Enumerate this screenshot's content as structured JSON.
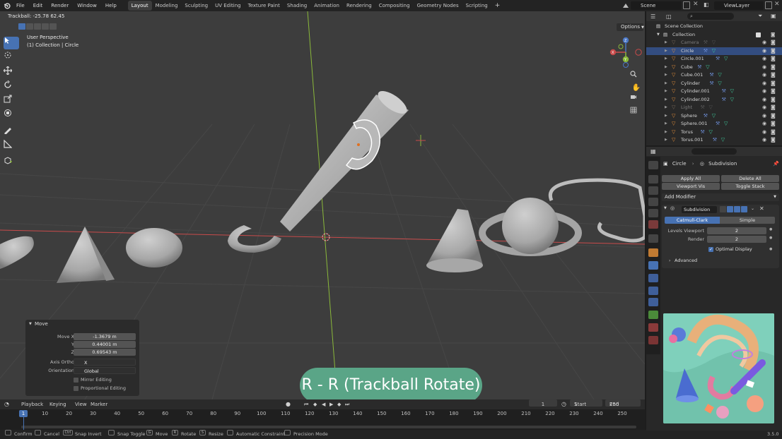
{
  "menu": [
    "File",
    "Edit",
    "Render",
    "Window",
    "Help"
  ],
  "workspaces": [
    "Layout",
    "Modeling",
    "Sculpting",
    "UV Editing",
    "Texture Paint",
    "Shading",
    "Animation",
    "Rendering",
    "Compositing",
    "Geometry Nodes",
    "Scripting"
  ],
  "active_workspace": "Layout",
  "add_workspace": "+",
  "scene": "Scene",
  "view_layer": "ViewLayer",
  "viewport": {
    "header_text": "Trackball: -25.78 62.45",
    "perspective": "User Perspective",
    "collection_info": "(1) Collection | Circle",
    "options": "Options",
    "gizmo_axes": [
      "X",
      "Y",
      "Z"
    ]
  },
  "operator_panel": {
    "title": "Move",
    "fields": [
      {
        "label": "Move X",
        "value": "-1.3679 m"
      },
      {
        "label": "Y",
        "value": "0.44001 m"
      },
      {
        "label": "Z",
        "value": "0.69543 m"
      }
    ],
    "axis_ortho_label": "Axis Ortho",
    "axis_ortho_value": "X",
    "orientation_label": "Orientation",
    "orientation_value": "Global",
    "mirror_editing": "Mirror Editing",
    "proportional_editing": "Proportional Editing"
  },
  "caption": "R - R (Trackball Rotate)",
  "timeline": {
    "menus": [
      "Playback",
      "Keying",
      "View",
      "Marker"
    ],
    "current_frame": "1",
    "start_label": "Start",
    "start_value": "1",
    "end_label": "End",
    "end_value": "250",
    "ticks": [
      "1",
      "10",
      "20",
      "30",
      "40",
      "50",
      "60",
      "70",
      "80",
      "90",
      "100",
      "110",
      "120",
      "130",
      "140",
      "150",
      "160",
      "170",
      "180",
      "190",
      "200",
      "210",
      "220",
      "230",
      "240",
      "250"
    ]
  },
  "statusbar": {
    "items": [
      "Confirm",
      "Cancel",
      "Snap Invert",
      "Snap Toggle",
      "Move",
      "Rotate",
      "Resize",
      "Automatic Constraint",
      "Precision Mode"
    ],
    "keys": [
      "",
      "",
      "Ctrl",
      "",
      "G",
      "R",
      "S",
      "",
      ""
    ],
    "version": "3.5.0"
  },
  "outliner": {
    "scene_collection": "Scene Collection",
    "collection": "Collection",
    "items": [
      {
        "name": "Camera",
        "dim": true,
        "selected": false
      },
      {
        "name": "Circle",
        "dim": false,
        "selected": true
      },
      {
        "name": "Circle.001",
        "dim": false,
        "selected": false
      },
      {
        "name": "Cube",
        "dim": false,
        "selected": false
      },
      {
        "name": "Cube.001",
        "dim": false,
        "selected": false
      },
      {
        "name": "Cylinder",
        "dim": false,
        "selected": false
      },
      {
        "name": "Cylinder.001",
        "dim": false,
        "selected": false
      },
      {
        "name": "Cylinder.002",
        "dim": false,
        "selected": false
      },
      {
        "name": "Light",
        "dim": true,
        "selected": false
      },
      {
        "name": "Sphere",
        "dim": false,
        "selected": false
      },
      {
        "name": "Sphere.001",
        "dim": false,
        "selected": false
      },
      {
        "name": "Torus",
        "dim": false,
        "selected": false
      },
      {
        "name": "Torus.001",
        "dim": false,
        "selected": false
      }
    ]
  },
  "properties": {
    "object": "Circle",
    "modifier_crumb": "Subdivision",
    "apply_all": "Apply All",
    "delete_all": "Delete All",
    "viewport_vis": "Viewport Vis",
    "toggle_stack": "Toggle Stack",
    "add_modifier": "Add Modifier",
    "modifier_name": "Subdivision",
    "catmull_clark": "Catmull-Clark",
    "simple": "Simple",
    "levels_viewport_label": "Levels Viewport",
    "levels_viewport_value": "2",
    "render_label": "Render",
    "render_value": "2",
    "optimal_display": "Optimal Display",
    "advanced": "Advanced"
  },
  "colors": {
    "accent": "#4772b3",
    "viewport_bg": "#3d3d3d",
    "caption_bg": "#5aa587",
    "x_axis": "#c94b4b",
    "y_axis": "#8ab83a"
  }
}
